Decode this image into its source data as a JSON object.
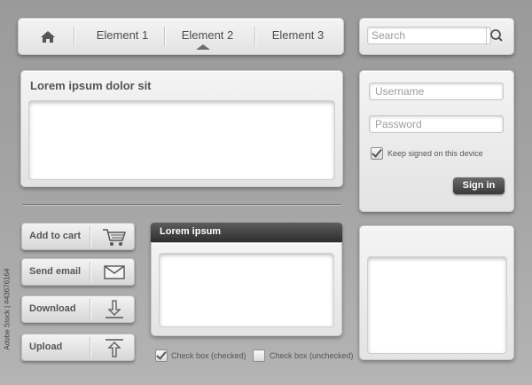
{
  "nav": {
    "items": [
      {
        "label": "Element 1"
      },
      {
        "label": "Element 2"
      },
      {
        "label": "Element 3"
      }
    ]
  },
  "search": {
    "placeholder": "Search"
  },
  "text_panel": {
    "title": "Lorem ipsum dolor sit"
  },
  "login": {
    "username_placeholder": "Username",
    "password_placeholder": "Password",
    "keep_signed_label": "Keep signed on this device",
    "signin_label": "Sign in"
  },
  "actions": [
    {
      "label": "Add to cart",
      "icon": "cart-icon"
    },
    {
      "label": "Send email",
      "icon": "envelope-icon"
    },
    {
      "label": "Download",
      "icon": "download-icon"
    },
    {
      "label": "Upload",
      "icon": "upload-icon"
    }
  ],
  "dark_panel": {
    "title": "Lorem ipsum"
  },
  "checkboxes": {
    "checked_label": "Check box (checked)",
    "unchecked_label": "Check box (unchecked)"
  },
  "side_text": "Adobe Stock | #43676164",
  "colors": {
    "dark_header": "#3a3a3a",
    "background": "#a3a3a3"
  }
}
